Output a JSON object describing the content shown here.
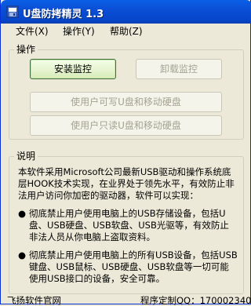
{
  "window": {
    "title": "U盘防拷精灵 1.3"
  },
  "menu": [
    {
      "label": "文件(X)"
    },
    {
      "label": "操作(Y)"
    },
    {
      "label": "帮助(Z)"
    }
  ],
  "operations": {
    "group_label": "操作",
    "install_label": "安装监控",
    "uninstall_label": "卸载监控",
    "allow_write_label": "使用户可写U盘和移动硬盘",
    "read_only_label": "使用户只读U盘和移动硬盘"
  },
  "description": {
    "group_label": "说明",
    "intro": "本软件采用Microsoft公司最新USB驱动和操作系统底层HOOK技术实现，在业界处于领先水平，有效防止非法用户访问你加密的驱动器，软件可以实现：",
    "bullets": [
      "彻底禁止用户使用电脑上的USB存储设备，包括U盘、USB硬盘、USB软盘、USB光驱等，有效防止非法人员从你电脑上盗取资料。",
      "彻底禁止用户使用电脑上的所有USB设备，包括USB键盘、USB鼠标、USB硬盘、USB软盘等一切可能使用USB接口的设备，安全可靠。"
    ],
    "bullet_glyph": "●"
  },
  "footer": {
    "left": "飞扬软件官网",
    "right": "程序定制QQ：170002340"
  },
  "colors": {
    "titlebar": "#0a4fd6",
    "window_bg": "#ece9d8",
    "active_button": "#e8f5d3"
  }
}
